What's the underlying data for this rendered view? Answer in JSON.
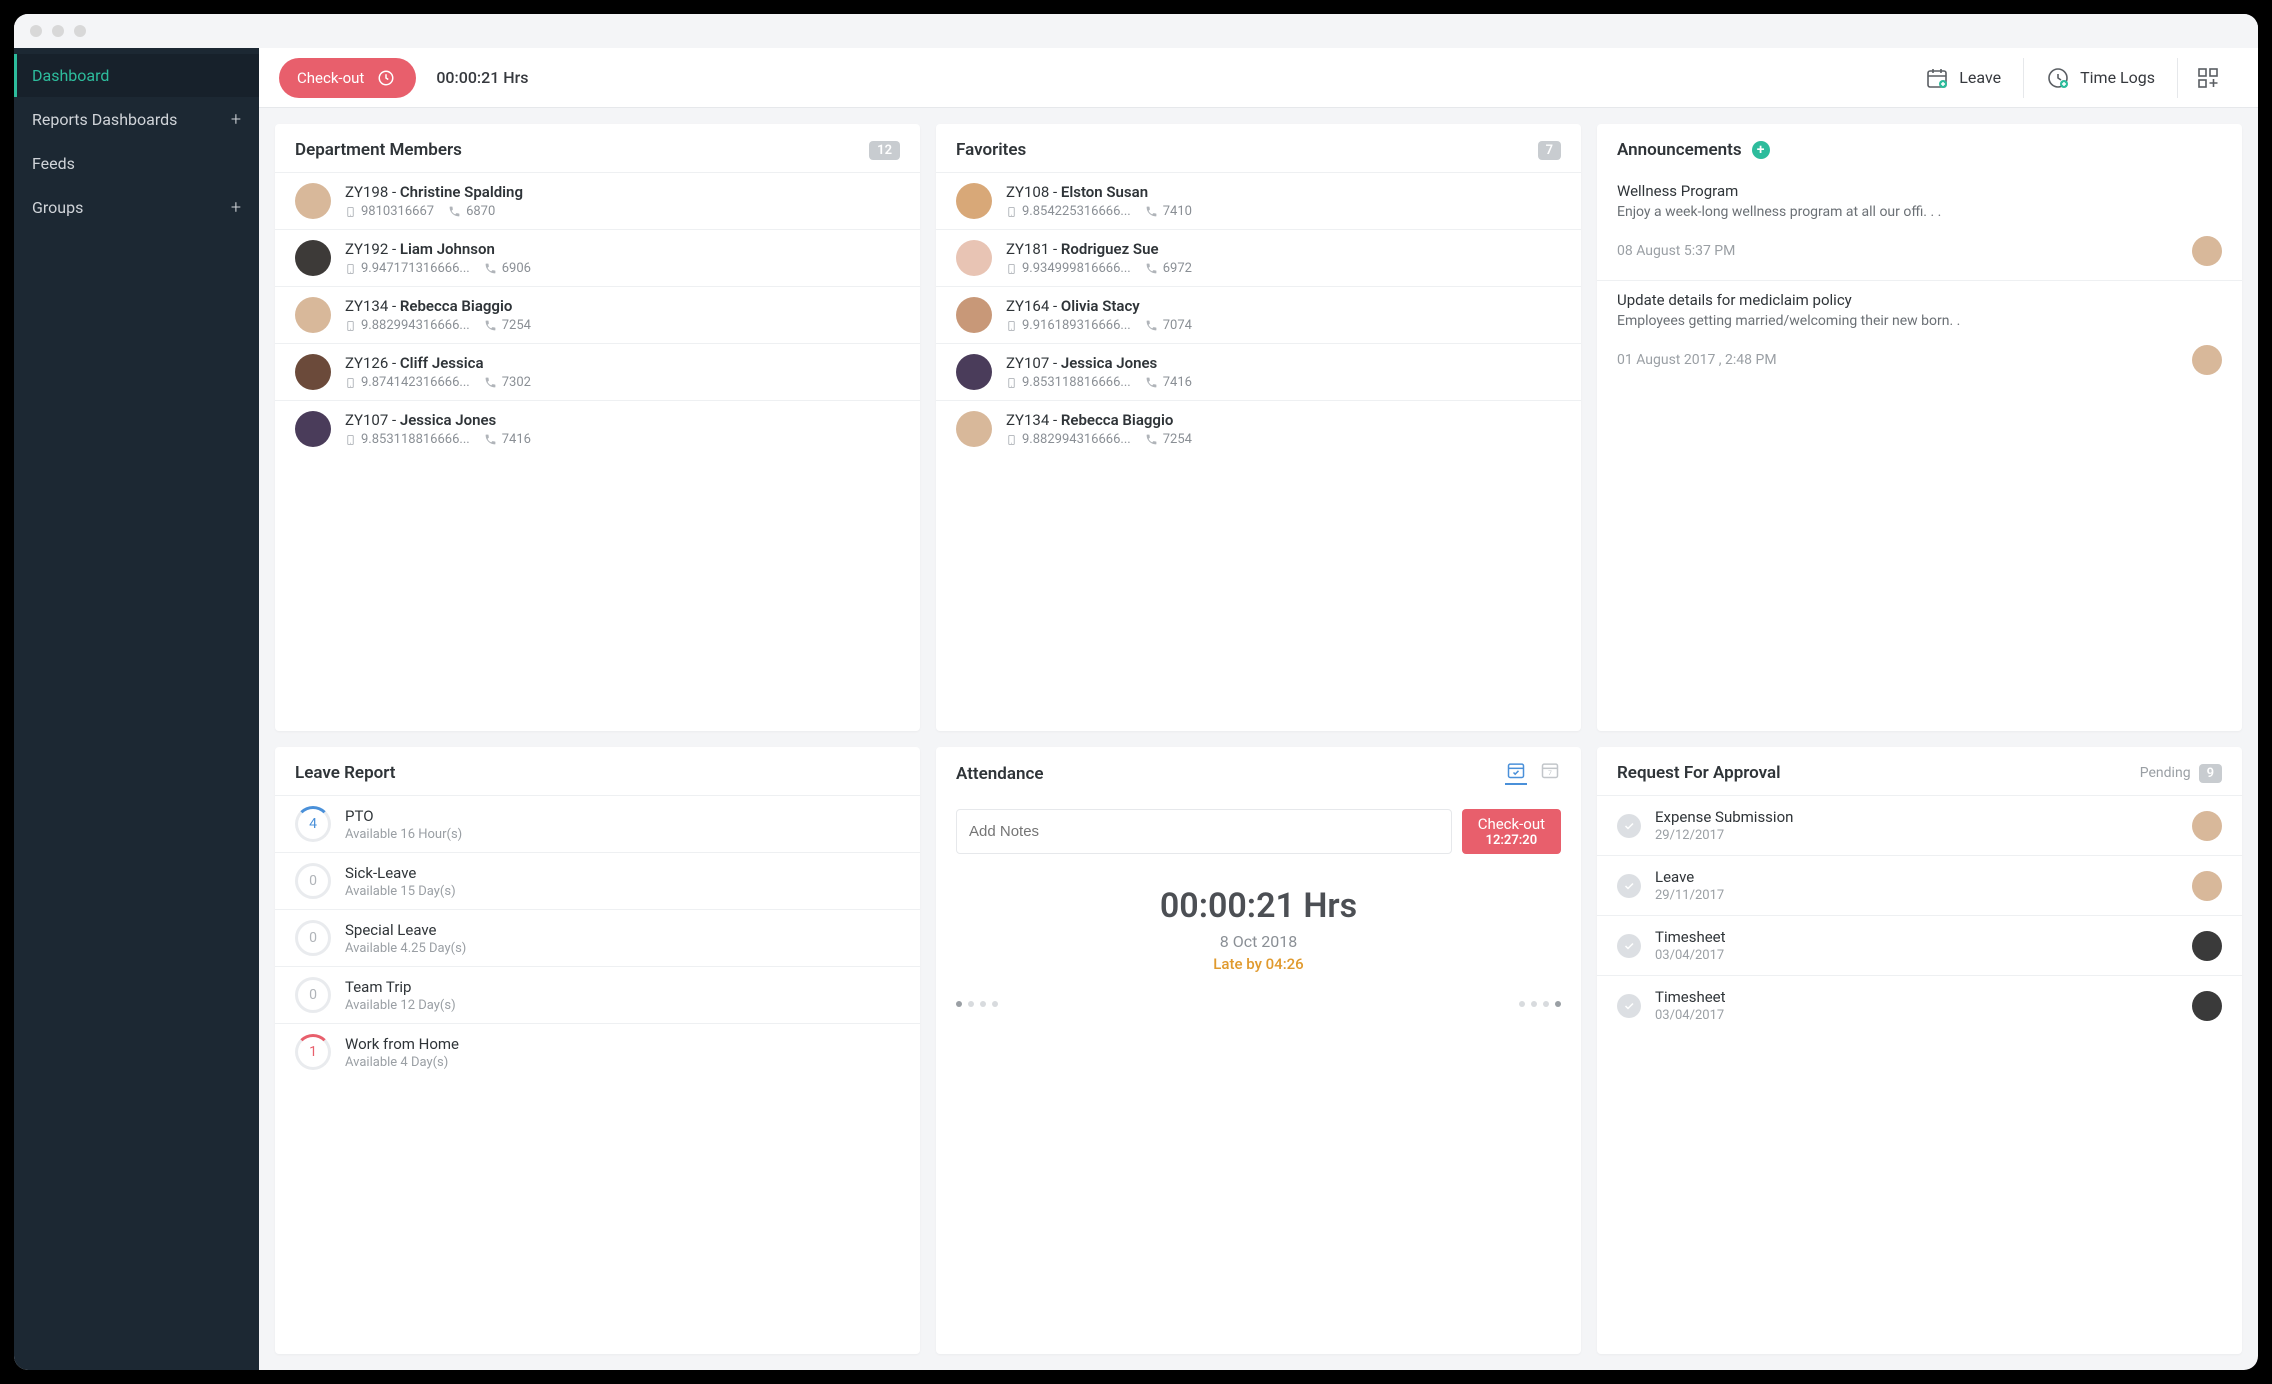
{
  "sidebar": {
    "items": [
      {
        "label": "Dashboard",
        "plus": false,
        "active": true
      },
      {
        "label": "Reports Dashboards",
        "plus": true,
        "active": false
      },
      {
        "label": "Feeds",
        "plus": false,
        "active": false
      },
      {
        "label": "Groups",
        "plus": true,
        "active": false
      }
    ]
  },
  "topbar": {
    "checkout_label": "Check-out",
    "timer": "00:00:21 Hrs",
    "leave_label": "Leave",
    "timelogs_label": "Time Logs"
  },
  "dept": {
    "title": "Department Members",
    "count": "12",
    "rows": [
      {
        "code": "ZY198",
        "name": "Christine Spalding",
        "mobile": "9810316667",
        "ext": "6870",
        "avatar": "#d8b89a"
      },
      {
        "code": "ZY192",
        "name": "Liam Johnson",
        "mobile": "9.947171316666...",
        "ext": "6906",
        "avatar": "#3d3a38"
      },
      {
        "code": "ZY134",
        "name": "Rebecca Biaggio",
        "mobile": "9.882994316666...",
        "ext": "7254",
        "avatar": "#d8b89a"
      },
      {
        "code": "ZY126",
        "name": "Cliff Jessica",
        "mobile": "9.874142316666...",
        "ext": "7302",
        "avatar": "#6b4a3a"
      },
      {
        "code": "ZY107",
        "name": "Jessica Jones",
        "mobile": "9.853118816666...",
        "ext": "7416",
        "avatar": "#4a3c5a"
      }
    ]
  },
  "favorites": {
    "title": "Favorites",
    "count": "7",
    "rows": [
      {
        "code": "ZY108",
        "name": "Elston Susan",
        "mobile": "9.854225316666...",
        "ext": "7410",
        "avatar": "#d8a878"
      },
      {
        "code": "ZY181",
        "name": "Rodriguez Sue",
        "mobile": "9.934999816666...",
        "ext": "6972",
        "avatar": "#e8c4b4"
      },
      {
        "code": "ZY164",
        "name": "Olivia Stacy",
        "mobile": "9.916189316666...",
        "ext": "7074",
        "avatar": "#c89878"
      },
      {
        "code": "ZY107",
        "name": "Jessica Jones",
        "mobile": "9.853118816666...",
        "ext": "7416",
        "avatar": "#4a3c5a"
      },
      {
        "code": "ZY134",
        "name": "Rebecca Biaggio",
        "mobile": "9.882994316666...",
        "ext": "7254",
        "avatar": "#d8b89a"
      }
    ]
  },
  "announcements": {
    "title": "Announcements",
    "items": [
      {
        "title": "Wellness Program",
        "desc": "Enjoy a week-long wellness program at all our offi. . .",
        "time": "08 August 5:37 PM",
        "avatar": "#d8b89a"
      },
      {
        "title": "Update details for mediclaim policy",
        "desc": "Employees getting married/welcoming their new born. .",
        "time": "01 August 2017 , 2:48 PM",
        "avatar": "#d8b89a"
      }
    ]
  },
  "leave_report": {
    "title": "Leave Report",
    "rows": [
      {
        "num": "4",
        "name": "PTO",
        "meta": "Available 16 Hour(s)",
        "style": "partial"
      },
      {
        "num": "0",
        "name": "Sick-Leave",
        "meta": "Available 15 Day(s)",
        "style": ""
      },
      {
        "num": "0",
        "name": "Special Leave",
        "meta": "Available 4.25 Day(s)",
        "style": ""
      },
      {
        "num": "0",
        "name": "Team Trip",
        "meta": "Available 12 Day(s)",
        "style": ""
      },
      {
        "num": "1",
        "name": "Work from Home",
        "meta": "Available 4 Day(s)",
        "style": "red"
      }
    ]
  },
  "attendance": {
    "title": "Attendance",
    "notes_placeholder": "Add Notes",
    "checkout_label": "Check-out",
    "checkout_time": "12:27:20",
    "big_timer": "00:00:21 Hrs",
    "date": "8 Oct 2018",
    "late": "Late by 04:26"
  },
  "approval": {
    "title": "Request For Approval",
    "pending_label": "Pending",
    "pending_count": "9",
    "rows": [
      {
        "name": "Expense Submission",
        "date": "29/12/2017",
        "avatar": "#d8b89a"
      },
      {
        "name": "Leave",
        "date": "29/11/2017",
        "avatar": "#d8b89a"
      },
      {
        "name": "Timesheet",
        "date": "03/04/2017",
        "avatar": "#3a3a3a"
      },
      {
        "name": "Timesheet",
        "date": "03/04/2017",
        "avatar": "#3a3a3a"
      }
    ]
  }
}
